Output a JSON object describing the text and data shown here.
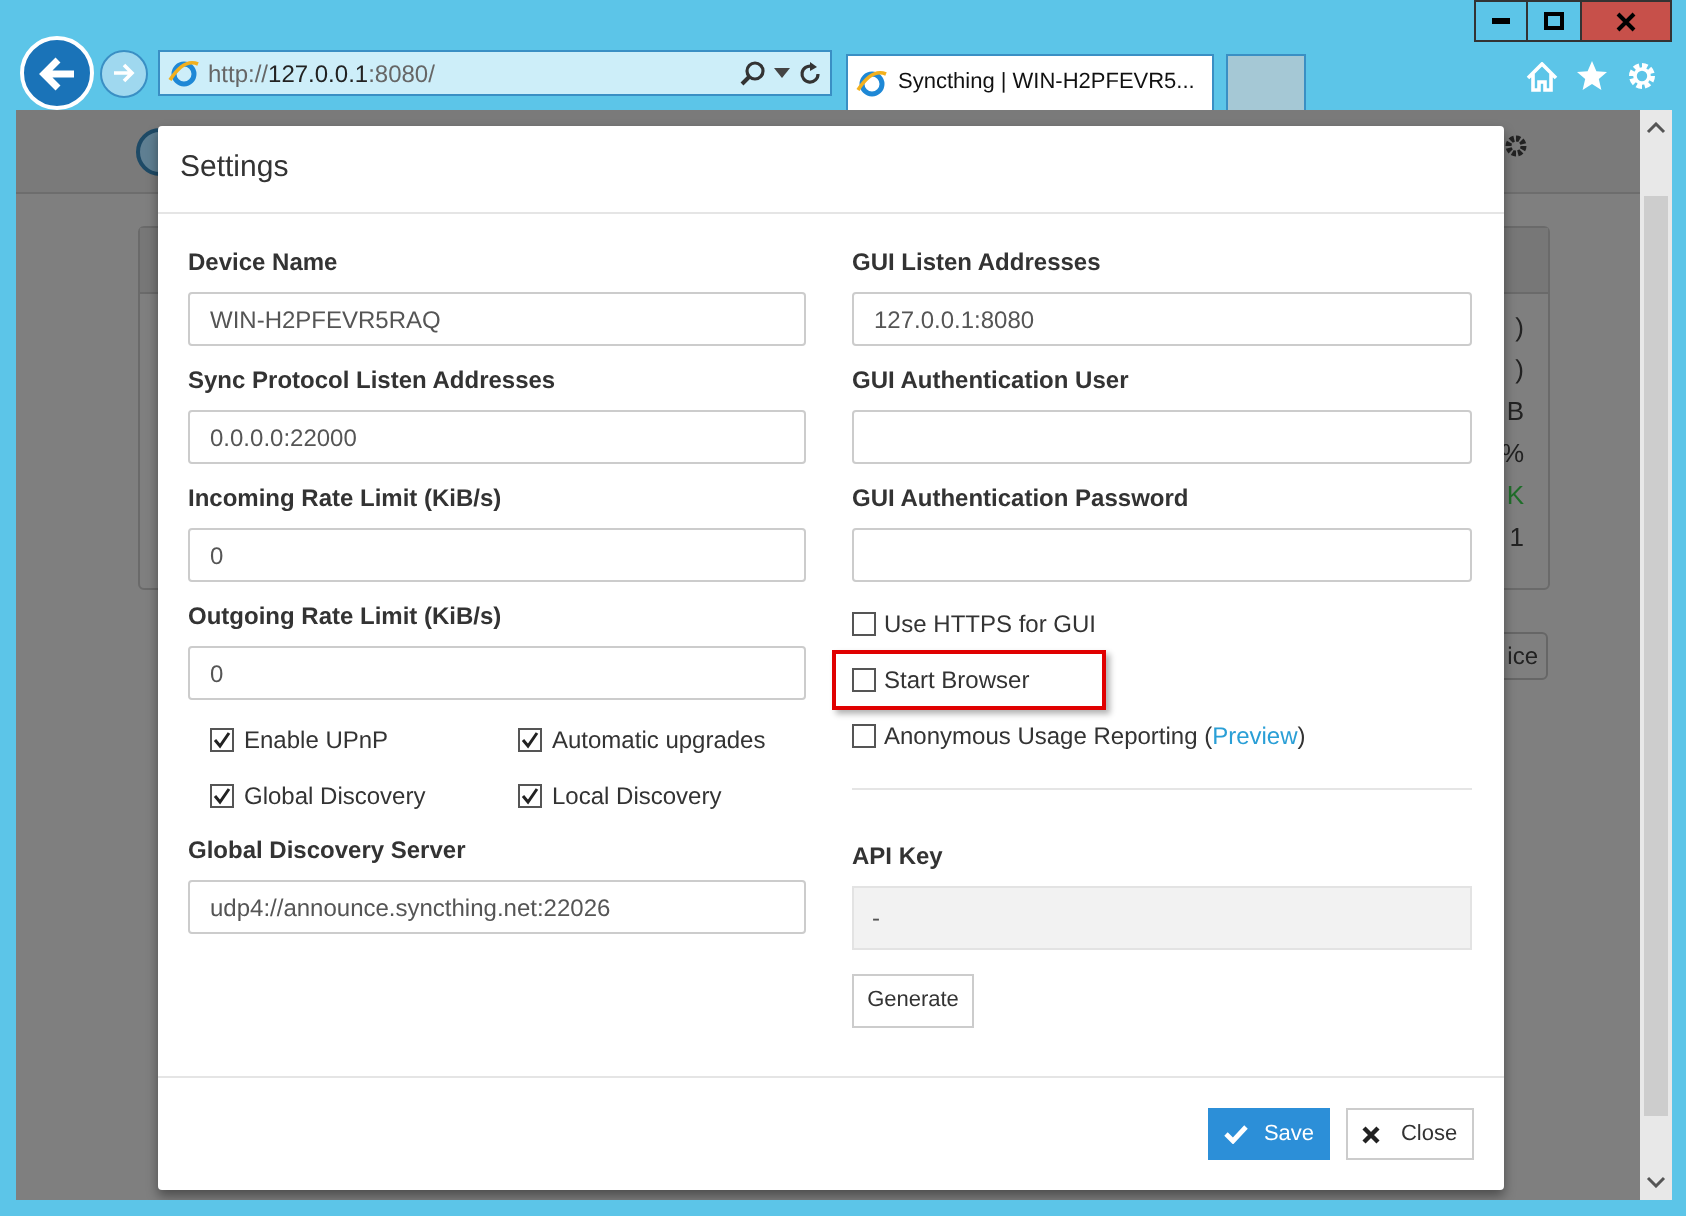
{
  "browser": {
    "address": {
      "scheme": "http://",
      "host": "127.0.0.1",
      "port": ":8080/"
    },
    "tabs": [
      {
        "title": "Syncthing | WIN-H2PFEVR5...",
        "selected": true
      }
    ]
  },
  "background_page": {
    "fragments": [
      {
        "text": ")",
        "kind": "plain"
      },
      {
        "text": ")",
        "kind": "plain"
      },
      {
        "text": "B",
        "kind": "plain"
      },
      {
        "text": "%",
        "kind": "plain"
      },
      {
        "text": "K",
        "kind": "ok"
      },
      {
        "text": "1",
        "kind": "plain"
      }
    ],
    "button": "ice"
  },
  "dialog": {
    "title": "Settings",
    "left_fields": [
      {
        "label": "Device Name",
        "value": "WIN-H2PFEVR5RAQ"
      },
      {
        "label": "Sync Protocol Listen Addresses",
        "value": "0.0.0.0:22000"
      },
      {
        "label": "Incoming Rate Limit (KiB/s)",
        "value": "0"
      },
      {
        "label": "Outgoing Rate Limit (KiB/s)",
        "value": "0"
      }
    ],
    "left_options": [
      {
        "label": "Enable UPnP",
        "checked": true
      },
      {
        "label": "Automatic upgrades",
        "checked": true
      },
      {
        "label": "Global Discovery",
        "checked": true
      },
      {
        "label": "Local Discovery",
        "checked": true
      }
    ],
    "discovery_server": {
      "label": "Global Discovery Server",
      "value": "udp4://announce.syncthing.net:22026"
    },
    "right_fields": [
      {
        "label": "GUI Listen Addresses",
        "value": "127.0.0.1:8080"
      },
      {
        "label": "GUI Authentication User"
      },
      {
        "label": "GUI Authentication Password"
      }
    ],
    "right_options": [
      {
        "label": "Use HTTPS for GUI",
        "checked": false,
        "highlighted": false
      },
      {
        "label": "Start Browser",
        "checked": false,
        "highlighted": true
      },
      {
        "label": "Anonymous Usage Reporting (",
        "link": "Preview",
        "after": ")",
        "checked": false,
        "highlighted": false
      }
    ],
    "api_key": {
      "label": "API Key",
      "value": "-",
      "button": "Generate"
    },
    "buttons": [
      {
        "label": "Save",
        "kind": "primary"
      },
      {
        "label": "Close",
        "kind": "default"
      }
    ]
  }
}
